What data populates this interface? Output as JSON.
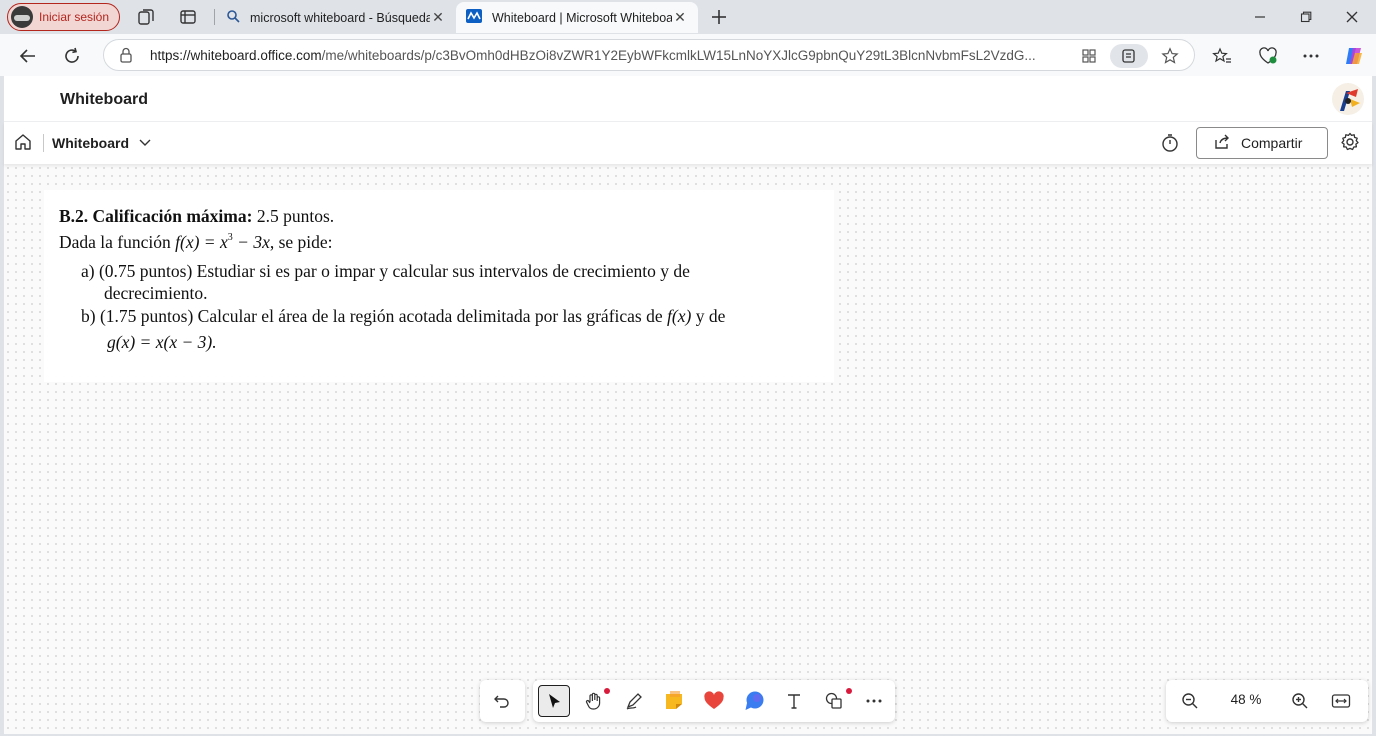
{
  "browser": {
    "signin_label": "Iniciar sesión",
    "tabs": [
      {
        "label": "microsoft whiteboard - Búsqueda",
        "icon": "search-icon"
      },
      {
        "label": "Whiteboard | Microsoft Whiteboard",
        "icon": "whiteboard-icon"
      }
    ],
    "url_host": "https://whiteboard.office.com",
    "url_path": "/me/whiteboards/p/c3BvOmh0dHBzOi8vZWR1Y2EybWFkcmlkLW15LnNoYXJlcG9pbnQuY29tL3BlcnNvbmFsL2VzdG..."
  },
  "app": {
    "title": "Whiteboard",
    "board_name": "Whiteboard",
    "share_label": "Compartir"
  },
  "document": {
    "l1_bold": "B.2. Calificación máxima:",
    "l1_rest": " 2.5 puntos.",
    "l2_a": "Dada la función ",
    "l2_fx": "f(x) = x",
    "l2_exp": "3",
    "l2_b": " − 3x",
    "l2_c": ", se pide:",
    "a_line1": "a) (0.75 puntos) Estudiar si es par o impar y calcular sus intervalos de crecimiento y de",
    "a_line2": "decrecimiento.",
    "b_line1_a": "b) (1.75 puntos) Calcular el área de la región acotada delimitada por las gráficas de ",
    "b_line1_fx": "f(x)",
    "b_line1_b": " y de",
    "b_line2": "g(x) = x(x − 3)."
  },
  "toolbar": {
    "zoom": "48 %"
  },
  "colors": {
    "signin_red": "#b3261e",
    "notification_dot": "#d81b3c",
    "tab_bg": "#dfe3e8"
  }
}
